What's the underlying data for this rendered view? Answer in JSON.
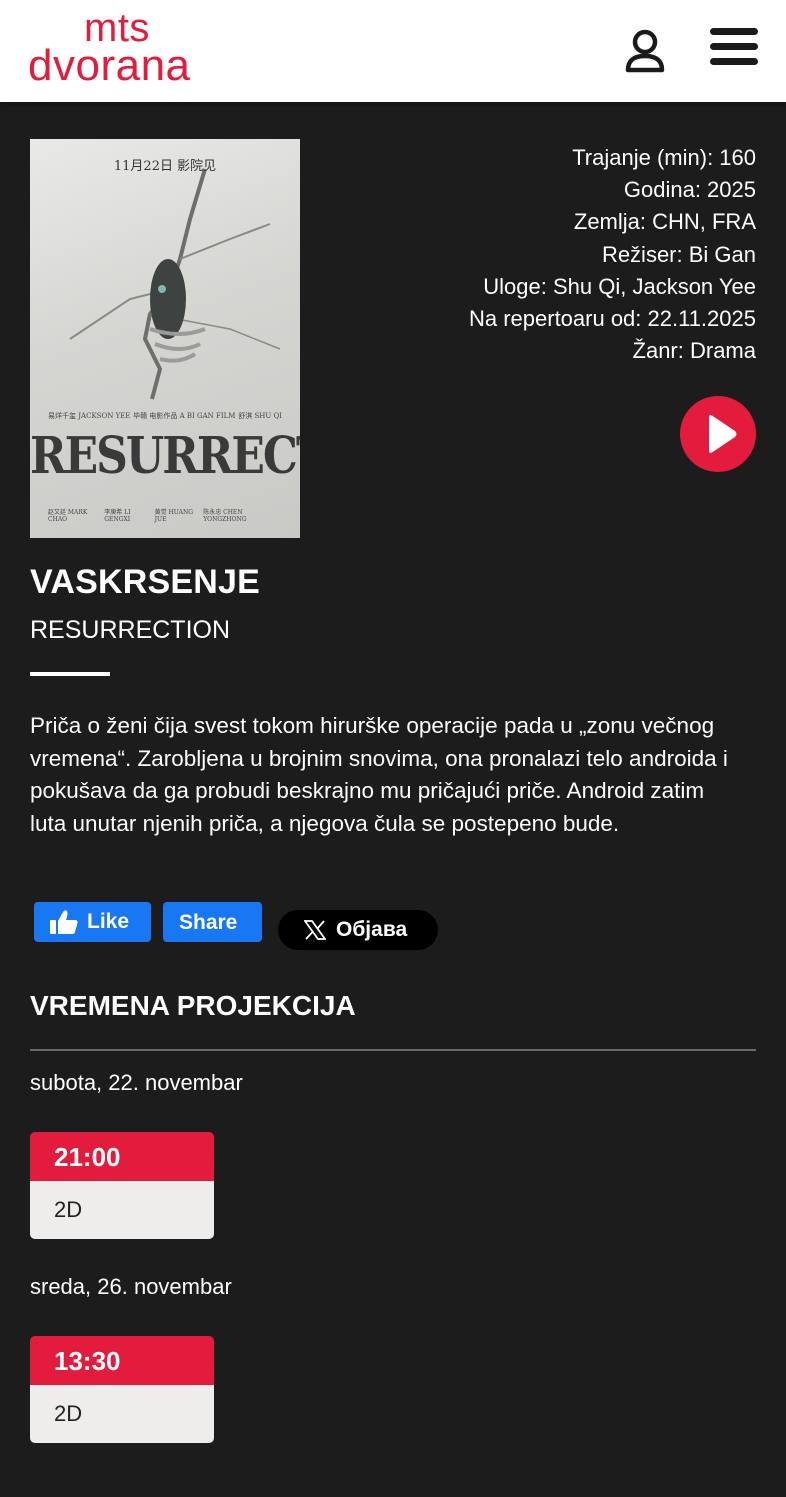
{
  "header": {
    "logo_line1": "mts",
    "logo_line2": "dvorana",
    "user_icon": "user-icon",
    "menu_icon": "hamburger-menu-icon"
  },
  "poster": {
    "date_text": "11月22日  影院见",
    "title_text": "RESURRECTION",
    "credits_left": "易烊千玺  JACKSON YEE",
    "credits_center": "毕赣 电影作品  A BI GAN FILM",
    "credits_right": "舒淇 SHU QI",
    "bottom_left": "赵又廷 MARK CHAO",
    "bottom_center_a": "李庚希 LI GENGXI",
    "bottom_center_b": "黄觉 HUANG JUE",
    "bottom_right": "陈永忠 CHEN YONGZHONG"
  },
  "info": {
    "duration": "Trajanje (min): 160",
    "year": "Godina: 2025",
    "country": "Zemlja: CHN, FRA",
    "director": "Režiser: Bi Gan",
    "cast": "Uloge: Shu Qi, Jackson Yee",
    "repertoire": "Na repertoaru od: 22.11.2025",
    "genre": "Žanr: Drama"
  },
  "movie": {
    "title": "VASKRSENJE",
    "original_title": "RESURRECTION",
    "description": "Priča o ženi čija svest tokom hirurške operacije pada u „zonu večnog vremena“. Zarobljena u brojnim snovima, ona pronalazi telo androida i pokušava da ga probudi beskrajno mu pričajući priče. Android zatim luta unutar njenih priča, a njegova čula se postepeno bude."
  },
  "social": {
    "like_label": "Like",
    "share_label": "Share",
    "post_label": "Објава"
  },
  "showtimes": {
    "section_title": "VREMENA PROJEKCIJA",
    "days": [
      {
        "date": "subota, 22. novembar",
        "time": "21:00",
        "format": "2D"
      },
      {
        "date": "sreda, 26. novembar",
        "time": "13:30",
        "format": "2D"
      }
    ]
  },
  "colors": {
    "accent": "#e31c3d",
    "background": "#1d1c1c",
    "facebook": "#1877f2"
  }
}
